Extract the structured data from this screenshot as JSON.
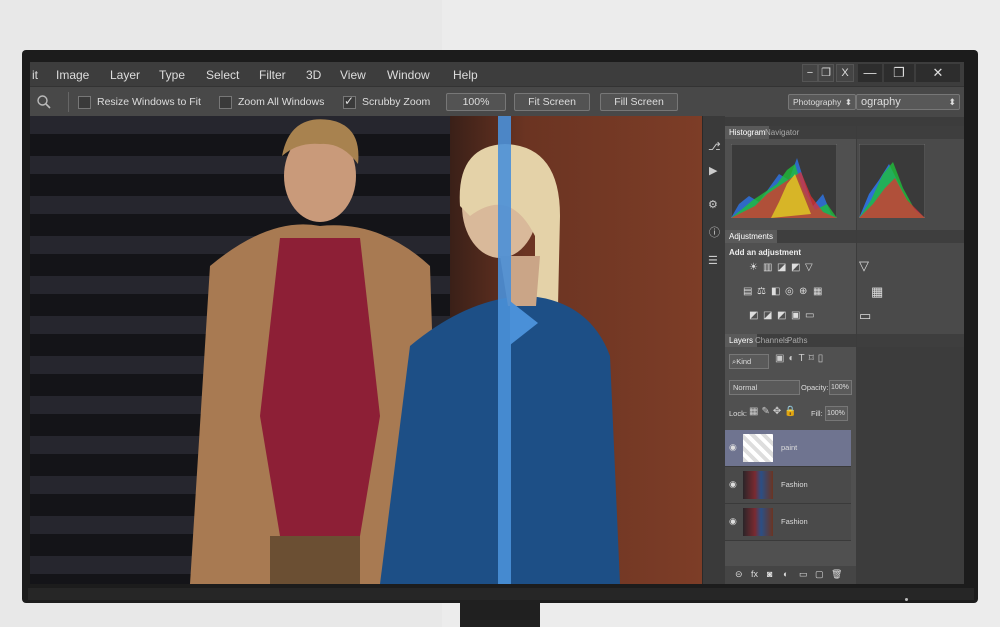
{
  "menu": {
    "items": [
      "it",
      "Image",
      "Layer",
      "Type",
      "Select",
      "Filter",
      "3D",
      "View",
      "Window",
      "Help"
    ],
    "window_buttons": [
      "−",
      "❐",
      "X"
    ],
    "big_buttons": [
      "—",
      "❐",
      "✕"
    ]
  },
  "options": {
    "resize_label": "Resize Windows to Fit",
    "zoom_all_label": "Zoom All Windows",
    "scrubby_label": "Scrubby Zoom",
    "scrubby_checked": true,
    "zoom_value": "100%",
    "fit_screen": "Fit Screen",
    "fill_screen": "Fill Screen",
    "workspace": "Photography",
    "workspace_overflow": "ography"
  },
  "panels": {
    "histogram_tab": "Histogram",
    "navigator_tab": "Navigator",
    "adjustments_tab": "Adjustments",
    "add_adjustment": "Add an adjustment",
    "layers_tab": "Layers",
    "channels_tab": "Channels",
    "paths_tab": "Paths",
    "kind_filter": "⌕Kind",
    "blend_mode": "Normal",
    "opacity_label": "Opacity:",
    "opacity_value": "100%",
    "lock_label": "Lock:",
    "fill_label": "Fill:",
    "fill_value": "100%",
    "layers": [
      {
        "name": "paint",
        "selected": true
      },
      {
        "name": "Fashion",
        "selected": false
      },
      {
        "name": "Fashion",
        "selected": false
      }
    ],
    "footer_icons": [
      "link-icon",
      "fx-icon",
      "mask-icon",
      "adjustment-icon",
      "folder-icon",
      "new-layer-icon",
      "trash-icon"
    ]
  },
  "colors": {
    "compare_bar": "#4a90d8",
    "selected_layer": "#6f7490"
  }
}
